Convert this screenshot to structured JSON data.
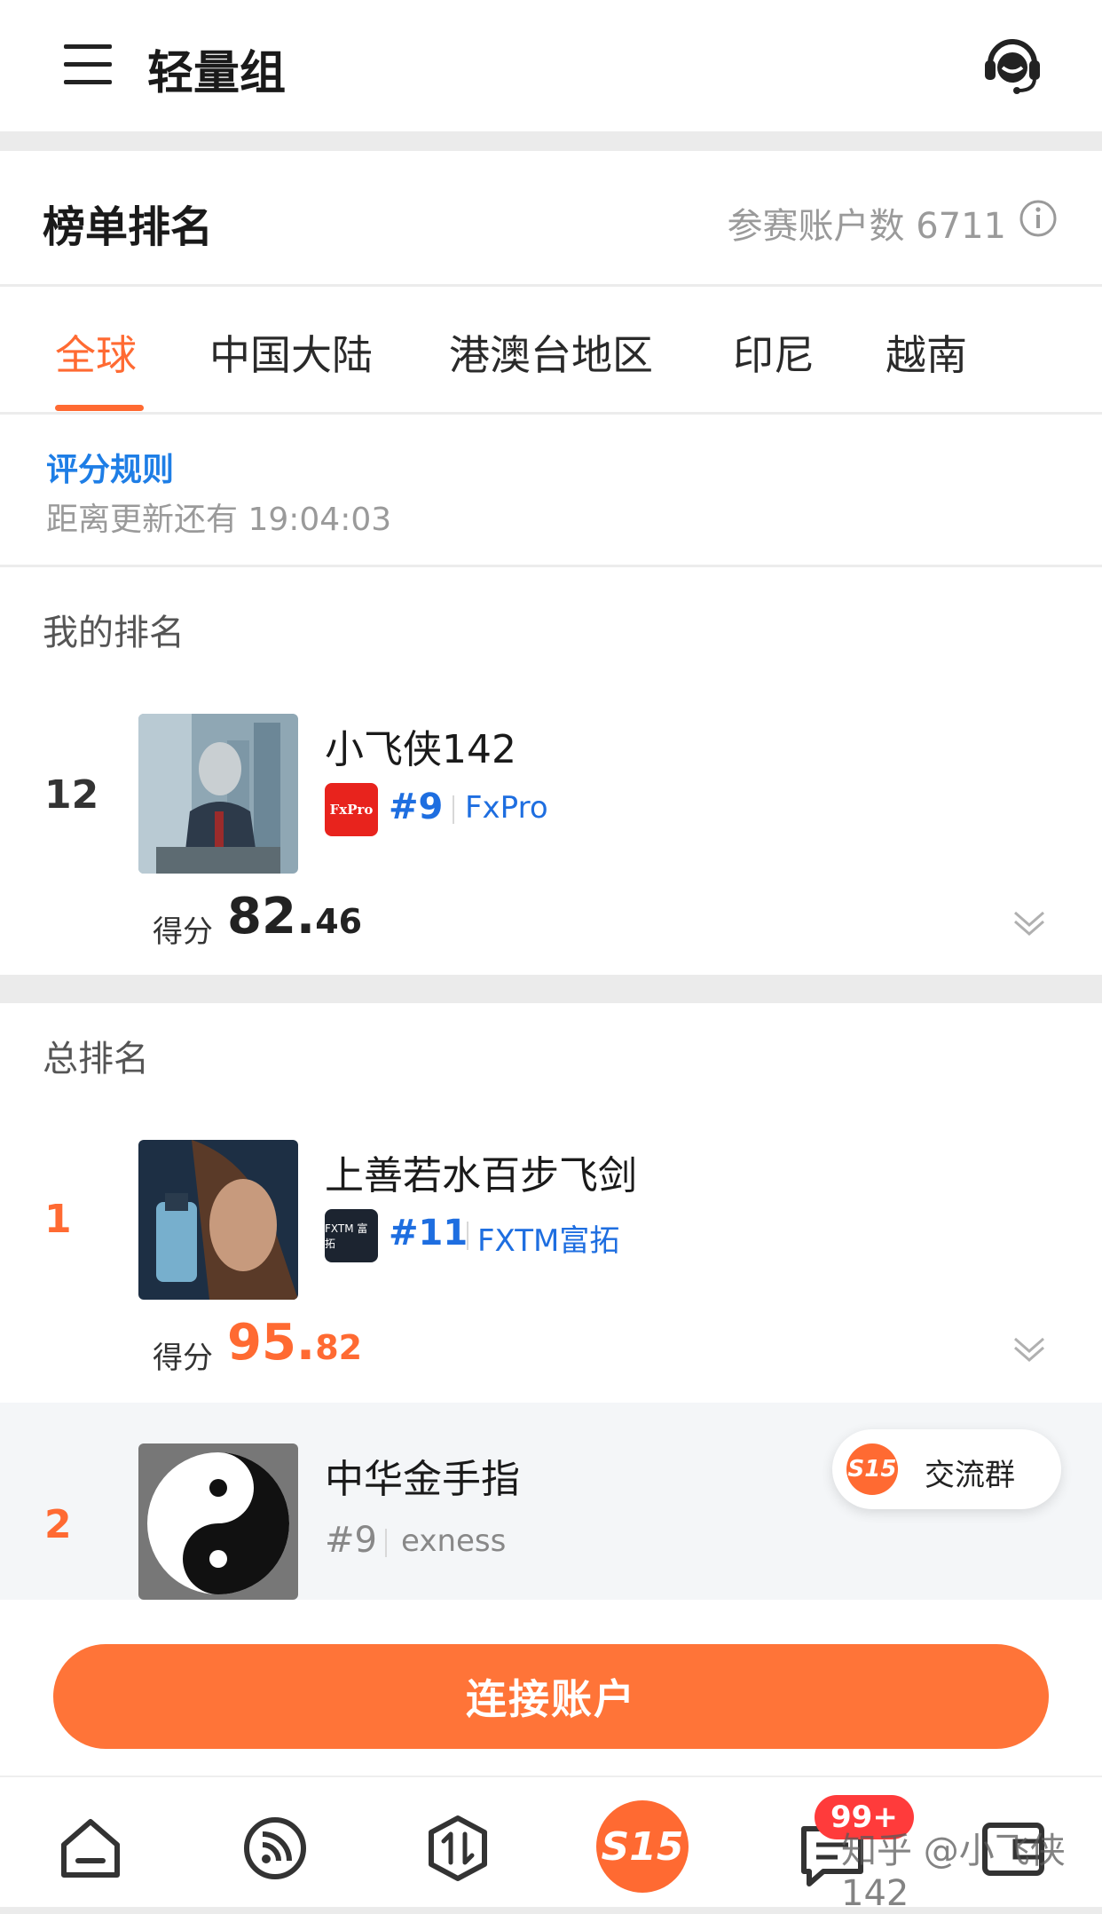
{
  "header": {
    "title": "轻量组"
  },
  "leaderboard": {
    "title": "榜单排名",
    "count_label": "参赛账户数 6711"
  },
  "tabs": [
    "全球",
    "中国大陆",
    "港澳台地区",
    "印尼",
    "越南"
  ],
  "rules": {
    "link": "评分规则",
    "countdown": "距离更新还有 19:04:03"
  },
  "my_rank": {
    "label": "我的排名",
    "rank": "12",
    "name": "小飞侠142",
    "broker_rank": "#9",
    "broker": "FxPro",
    "broker_logo_text": "FxPro",
    "score_label": "得分",
    "score_int": "82.",
    "score_dec": "46"
  },
  "overall": {
    "label": "总排名",
    "entries": [
      {
        "rank": "1",
        "name": "上善若水百步飞剑",
        "broker_rank": "#11",
        "broker": "FXTM富拓",
        "broker_logo_text": "FXTM 富拓",
        "score_label": "得分",
        "score_int": "95.",
        "score_dec": "82"
      },
      {
        "rank": "2",
        "name": "中华金手指",
        "broker_rank": "#9",
        "broker": "exness"
      }
    ]
  },
  "floating": {
    "logo": "S15",
    "label": "交流群"
  },
  "cta": {
    "label": "连接账户"
  },
  "nav": {
    "items": [
      "home-icon",
      "rss-icon",
      "trade-icon",
      "s15-icon",
      "message-icon",
      "wallet-icon"
    ],
    "center_logo": "S15",
    "badge": "99+"
  },
  "watermark": "知乎 @小飞侠142",
  "colors": {
    "accent": "#ff6a32",
    "link": "#1e6ee0",
    "cta": "#ff7438"
  }
}
